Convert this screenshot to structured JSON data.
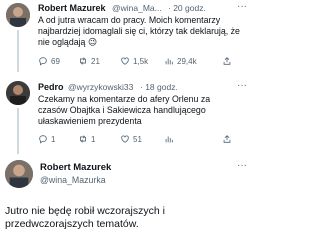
{
  "tweet1": {
    "name": "Robert Mazurek",
    "handle": "@wina_Ma...",
    "time": "· 20 godz.",
    "text": "A od jutra wracam do pracy. Moich komentarzy najbardziej idomaglali się ci, którzy tak deklarują, że nie oglądają 😉",
    "stats": {
      "replies": "69",
      "retweets": "21",
      "likes": "1,5k",
      "views": "29,4k"
    }
  },
  "tweet2": {
    "name": "Pedro",
    "handle": "@wyrzykowski33",
    "time": "· 18 godz.",
    "text": "Czekamy na komentarze do afery Orlenu za czasów Obajtka i Sakiewicza handlującego ułaskawieniem prezydenta",
    "stats": {
      "replies": "1",
      "retweets": "1",
      "likes": "51",
      "views": ""
    }
  },
  "main_tweet": {
    "name": "Robert Mazurek",
    "handle": "@wina_Mazurka",
    "text": "Jutro nie będę robił wczorajszych i przedwczorajszych tematów."
  },
  "icons": [
    "reply-icon",
    "retweet-icon",
    "like-icon",
    "views-icon",
    "share-icon"
  ]
}
